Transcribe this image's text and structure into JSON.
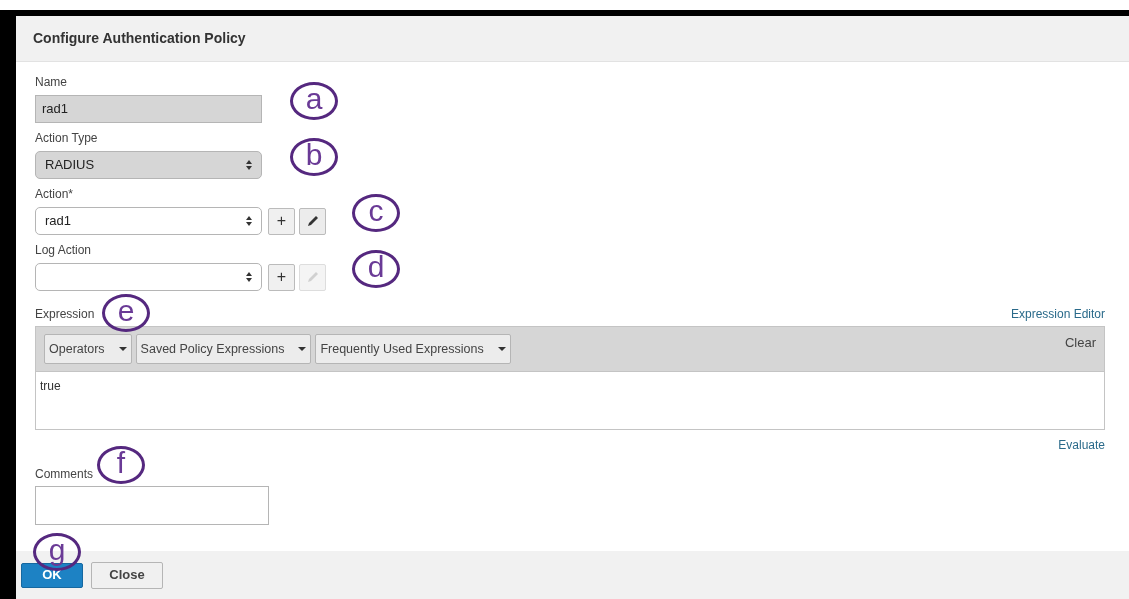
{
  "dialog": {
    "title": "Configure Authentication Policy"
  },
  "fields": [
    {
      "kind": "text",
      "label": "Name",
      "value": "rad1",
      "disabled": true,
      "callout": "a"
    },
    {
      "kind": "select",
      "label": "Action Type",
      "value": "RADIUS",
      "disabled": true,
      "callout": "b"
    },
    {
      "kind": "select",
      "label": "Action*",
      "value": "rad1",
      "disabled": false,
      "add": "+",
      "edit_disabled": false,
      "callout": "c"
    },
    {
      "kind": "select",
      "label": "Log Action",
      "disabled": false,
      "add": "+",
      "edit_disabled": true,
      "callout": "d"
    }
  ],
  "expression": {
    "label": "Expression",
    "callout": "e",
    "editor_link": "Expression Editor",
    "menus": [
      "Operators",
      "Saved Policy Expressions",
      "Frequently Used Expressions"
    ],
    "clear": "Clear",
    "value": "true",
    "evaluate_link": "Evaluate"
  },
  "comments": {
    "label": "Comments",
    "callout": "f"
  },
  "footer": {
    "callout": "g",
    "buttons": [
      {
        "label": "OK",
        "kind": "primary"
      },
      {
        "label": "Close",
        "kind": "secondary"
      }
    ]
  }
}
